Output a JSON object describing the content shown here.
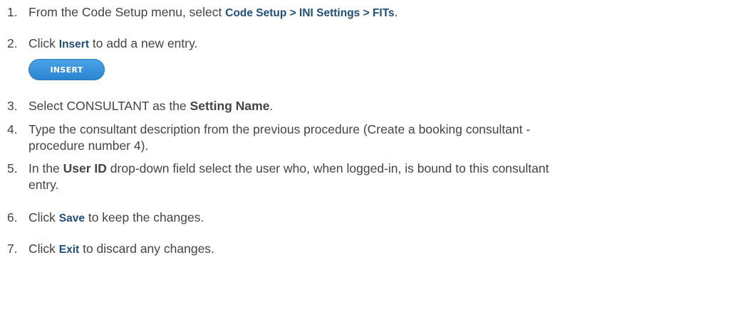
{
  "steps": [
    {
      "num": "1.",
      "text_1": "From the Code Setup menu, select ",
      "cmd": "Code Setup > INI Settings > FITs",
      "text_2": "."
    },
    {
      "num": "2.",
      "text_1": "Click ",
      "cmd": "Insert",
      "text_2": " to add a new entry."
    },
    {
      "num": "3.",
      "text_1": "Select CONSULTANT as the ",
      "field": "Setting Name",
      "text_2": "."
    },
    {
      "num": "4.",
      "line_1": "Type the consultant description from the previous procedure (Create a booking consultant -",
      "line_2": "procedure number 4)."
    },
    {
      "num": "5.",
      "text_1": "In the ",
      "field": "User ID",
      "text_2": " drop-down field select the user who, when logged-in, is bound to this consultant",
      "line_2": "entry."
    },
    {
      "num": "6.",
      "text_1": "Click ",
      "cmd": "Save",
      "text_2": " to keep the changes."
    },
    {
      "num": "7.",
      "text_1": "Click ",
      "cmd": "Exit",
      "text_2": " to discard any changes."
    }
  ],
  "insert_button": {
    "label": "INSERT"
  }
}
